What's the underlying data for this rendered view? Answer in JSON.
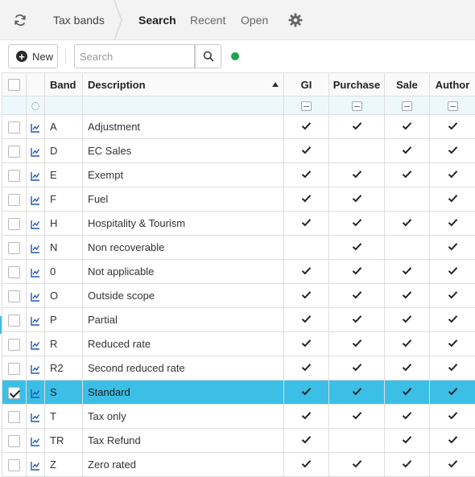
{
  "nav": {
    "breadcrumb": "Tax bands",
    "tabs": [
      {
        "label": "Search",
        "active": true
      },
      {
        "label": "Recent",
        "active": false
      },
      {
        "label": "Open",
        "active": false
      }
    ],
    "icons": {
      "refresh": "refresh-icon",
      "settings": "gear-icon"
    }
  },
  "toolbar": {
    "new_label": "New",
    "search_placeholder": "Search",
    "search_value": "",
    "status_color": "#1aa64a"
  },
  "grid": {
    "columns": {
      "band": "Band",
      "description": "Description",
      "gl": "GI",
      "purchase": "Purchase",
      "sale": "Sale",
      "author": "Author"
    },
    "sort": {
      "column": "description",
      "direction": "asc"
    },
    "selected_color": "#3cbfe7",
    "rows": [
      {
        "band": "A",
        "description": "Adjustment",
        "gl": true,
        "purchase": true,
        "sale": true,
        "author": true,
        "selected": false
      },
      {
        "band": "D",
        "description": "EC Sales",
        "gl": true,
        "purchase": false,
        "sale": true,
        "author": true,
        "selected": false
      },
      {
        "band": "E",
        "description": "Exempt",
        "gl": true,
        "purchase": true,
        "sale": true,
        "author": true,
        "selected": false
      },
      {
        "band": "F",
        "description": "Fuel",
        "gl": true,
        "purchase": true,
        "sale": false,
        "author": true,
        "selected": false
      },
      {
        "band": "H",
        "description": "Hospitality & Tourism",
        "gl": true,
        "purchase": true,
        "sale": true,
        "author": true,
        "selected": false
      },
      {
        "band": "N",
        "description": "Non recoverable",
        "gl": false,
        "purchase": true,
        "sale": false,
        "author": true,
        "selected": false
      },
      {
        "band": "0",
        "description": "Not applicable",
        "gl": true,
        "purchase": true,
        "sale": true,
        "author": true,
        "selected": false
      },
      {
        "band": "O",
        "description": "Outside scope",
        "gl": true,
        "purchase": true,
        "sale": true,
        "author": true,
        "selected": false
      },
      {
        "band": "P",
        "description": "Partial",
        "gl": true,
        "purchase": true,
        "sale": true,
        "author": true,
        "selected": false
      },
      {
        "band": "R",
        "description": "Reduced rate",
        "gl": true,
        "purchase": true,
        "sale": true,
        "author": true,
        "selected": false
      },
      {
        "band": "R2",
        "description": "Second reduced rate",
        "gl": true,
        "purchase": true,
        "sale": true,
        "author": true,
        "selected": false
      },
      {
        "band": "S",
        "description": "Standard",
        "gl": true,
        "purchase": true,
        "sale": true,
        "author": true,
        "selected": true
      },
      {
        "band": "T",
        "description": "Tax only",
        "gl": true,
        "purchase": true,
        "sale": true,
        "author": true,
        "selected": false
      },
      {
        "band": "TR",
        "description": "Tax Refund",
        "gl": true,
        "purchase": false,
        "sale": true,
        "author": true,
        "selected": false
      },
      {
        "band": "Z",
        "description": "Zero rated",
        "gl": true,
        "purchase": true,
        "sale": true,
        "author": true,
        "selected": false
      }
    ]
  }
}
